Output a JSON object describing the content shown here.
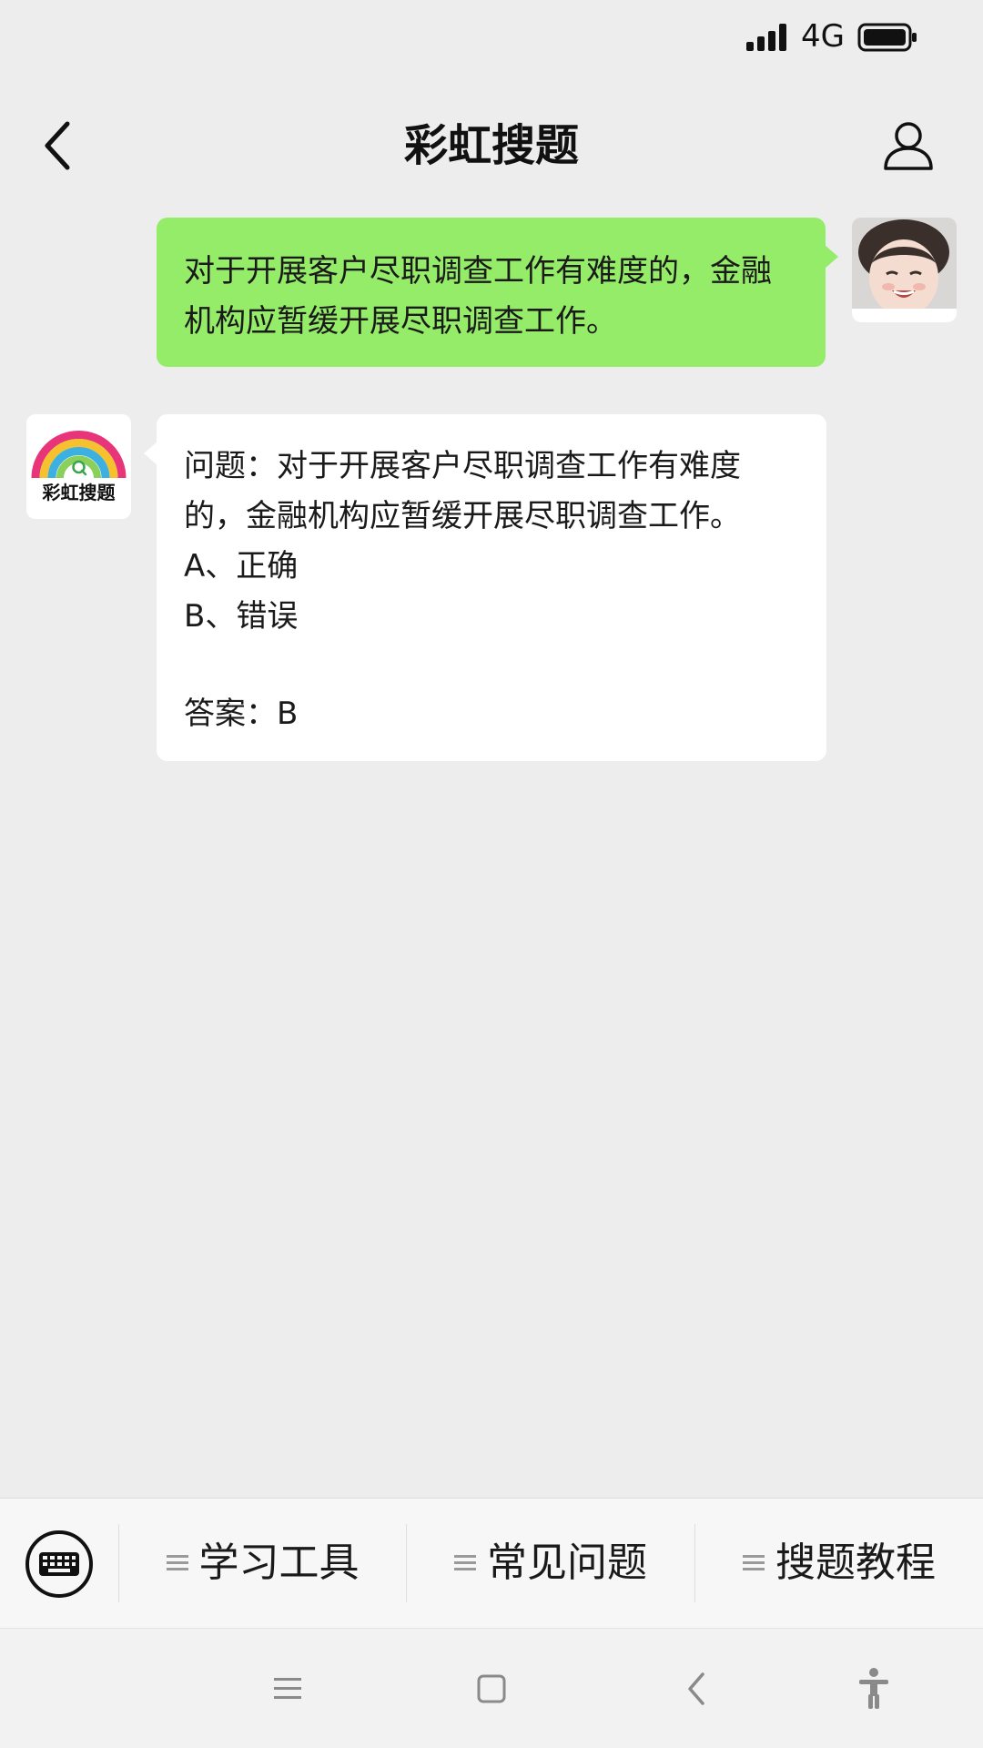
{
  "status_bar": {
    "network": "4G",
    "signal_icon": "signal-bars-icon",
    "battery_icon": "battery-full-icon"
  },
  "nav": {
    "title": "彩虹搜题",
    "back_icon": "chevron-left-icon",
    "profile_icon": "person-icon"
  },
  "messages": {
    "user": {
      "text": "对于开展客户尽职调查工作有难度的，金融机构应暂缓开展尽职调查工作。",
      "bubble_color": "#95ec69"
    },
    "bot": {
      "avatar_label": "彩虹搜题",
      "question": "问题：对于开展客户尽职调查工作有难度的，金融机构应暂缓开展尽职调查工作。",
      "options": [
        "A、正确",
        "B、错误"
      ],
      "answer": "答案：B"
    }
  },
  "menu": {
    "keyboard_icon": "keyboard-icon",
    "items": [
      {
        "label": "学习工具",
        "icon": "menu-lines-icon"
      },
      {
        "label": "常见问题",
        "icon": "menu-lines-icon"
      },
      {
        "label": "搜题教程",
        "icon": "menu-lines-icon"
      }
    ]
  },
  "system_nav": {
    "icons": [
      "menu-icon",
      "home-square-icon",
      "back-triangle-icon",
      "accessibility-icon"
    ]
  },
  "colors": {
    "background": "#ededed",
    "user_bubble": "#95ec69",
    "bot_bubble": "#ffffff"
  }
}
